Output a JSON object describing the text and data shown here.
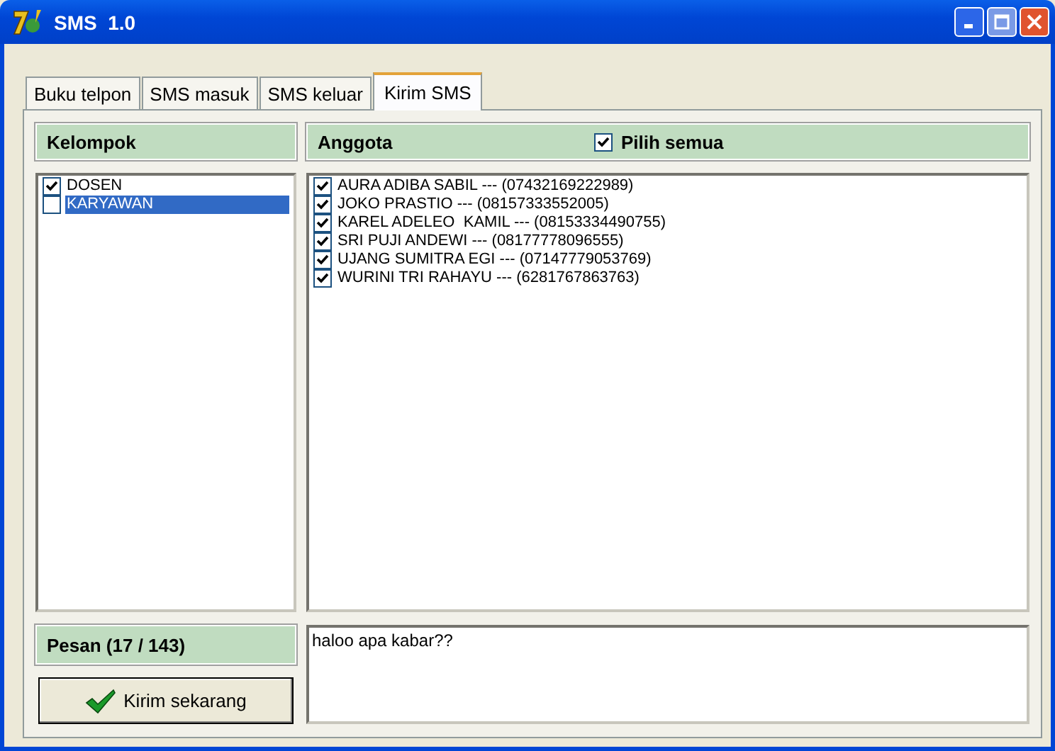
{
  "window": {
    "title": "SMS  1.0"
  },
  "tabs": [
    {
      "label": "Buku telpon",
      "selected": false
    },
    {
      "label": "SMS masuk",
      "selected": false
    },
    {
      "label": "SMS keluar",
      "selected": false
    },
    {
      "label": "Kirim SMS",
      "selected": true
    }
  ],
  "groups": {
    "header": "Kelompok",
    "items": [
      {
        "label": "DOSEN",
        "checked": true,
        "selected": false
      },
      {
        "label": "KARYAWAN",
        "checked": false,
        "selected": true
      }
    ]
  },
  "members": {
    "header": "Anggota",
    "select_all": {
      "label": "Pilih semua",
      "checked": true
    },
    "items": [
      {
        "label": "AURA ADIBA SABIL --- (07432169222989)",
        "checked": true
      },
      {
        "label": "JOKO PRASTIO --- (08157333552005)",
        "checked": true
      },
      {
        "label": "KAREL ADELEO  KAMIL --- (08153334490755)",
        "checked": true
      },
      {
        "label": "SRI PUJI ANDEWI --- (08177778096555)",
        "checked": true
      },
      {
        "label": "UJANG SUMITRA EGI --- (07147779053769)",
        "checked": true
      },
      {
        "label": "WURINI TRI RAHAYU --- (6281767863763)",
        "checked": true
      }
    ]
  },
  "message": {
    "label": "Pesan (17 / 143)",
    "value": "haloo apa kabar??"
  },
  "send_button": {
    "label": "Kirim sekarang"
  }
}
